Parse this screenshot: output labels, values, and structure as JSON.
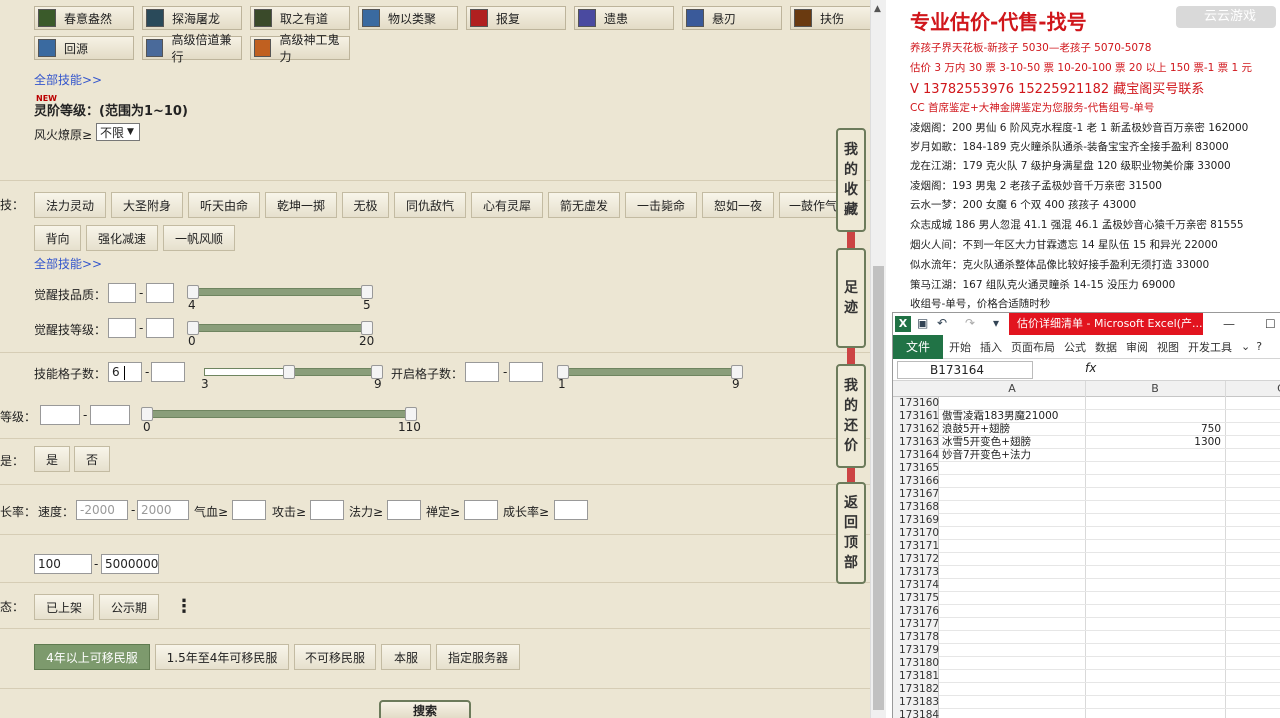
{
  "skills_top": [
    "春意盎然",
    "探海屠龙",
    "取之有道",
    "物以类聚",
    "报复",
    "遗患",
    "悬刃",
    "扶伤",
    "回源",
    "高级倍道兼行",
    "高级神工鬼力"
  ],
  "all_skills_link": "全部技能>>",
  "new_tag": "NEW",
  "lingjie_label": "灵阶等级：(范围为1~10)",
  "fenghuo_label": "风火燎原≥",
  "fenghuo_value": "不限",
  "texiao_label": "技：",
  "texiao_row1": [
    "法力灵动",
    "大圣附身",
    "听天由命",
    "乾坤一掷",
    "无极",
    "同仇敌忾",
    "心有灵犀",
    "箭无虚发",
    "一击毙命",
    "恕如一夜",
    "一鼓作气"
  ],
  "texiao_row2": [
    "背向",
    "强化减速",
    "一帆风顺"
  ],
  "all_skills_link2": "全部技能>>",
  "juexing_quality": {
    "label": "觉醒技品质：",
    "min": "4",
    "max": "5"
  },
  "juexing_level": {
    "label": "觉醒技等级：",
    "min": "0",
    "max": "20"
  },
  "skill_slots": {
    "label": "技能格子数：",
    "value": "6",
    "min": "3",
    "max": "9",
    "selected": 6
  },
  "open_slots": {
    "label": "开启格子数：",
    "min": "1",
    "max": "9"
  },
  "level": {
    "label": "等级：",
    "min": "0",
    "max": "110"
  },
  "yesno_label": "是：",
  "yes": "是",
  "no": "否",
  "growth": {
    "label": "长率：",
    "speed_label": "速度：",
    "speed_min": "-2000",
    "speed_max": "2000",
    "qixue": "气血≥",
    "gongji": "攻击≥",
    "fali": "法力≥",
    "chanding": "禅定≥",
    "chengzhang": "成长率≥"
  },
  "price": {
    "min": "100",
    "max": "5000000"
  },
  "status_label": "态：",
  "status": [
    "已上架",
    "公示期"
  ],
  "server_options": [
    "4年以上可移民服",
    "1.5年至4年可移民服",
    "不可移民服",
    "本服",
    "指定服务器"
  ],
  "search": "搜索",
  "side_tabs": [
    [
      "我",
      "的",
      "收",
      "藏"
    ],
    [
      "足",
      "迹"
    ],
    [
      "我",
      "的",
      "还",
      "价"
    ],
    [
      "返",
      "回",
      "顶",
      "部"
    ]
  ],
  "ad": {
    "title": "专业估价-代售-找号",
    "watermark": "云云游戏",
    "lines": [
      "养孩子界天花板-新孩子 5030—老孩子 5070-5078",
      "估价 3 万内 30 票  3-10-50 票  10-20-100 票  20 以上 150 票-1 票 1 元",
      "V 13782553976    15225921182   藏宝阁买号联系",
      "CC 首席鉴定+大神金牌鉴定为您服务-代售组号-单号",
      "凌烟阁：200 男仙 6 阶风克水程度-1 老 1 新孟极妙音百万亲密 162000",
      "岁月如歌：184-189 克火瞳杀队通杀-装备宝宝齐全接手盈利 83000",
      "龙在江湖：179 克火队 7 级护身满星盘 120 级职业物美价廉 33000",
      "凌烟阁：193 男鬼 2 老孩子孟极妙音千万亲密 31500",
      "云水一梦：200 女魔 6 个双 400 孩孩子 43000",
      "众志成城 186 男人忽混 41.1 强混 46.1 孟极妙音心猿千万亲密 81555",
      "烟火人间：不到一年区大力甘霖遗忘 14 星队伍 15 和异光 22000",
      "似水流年：克火队通杀整体品像比较好接手盈利无须打造 33000",
      "策马江湖：167 组队克火通灵瞳杀 14-15 没压力 69000",
      "收组号-单号，价格合适随时秒"
    ]
  },
  "excel": {
    "title": "估价详细清单 - Microsoft Excel(产...",
    "file_tab": "文件",
    "tabs": [
      "开始",
      "插入",
      "页面布局",
      "公式",
      "数据",
      "审阅",
      "视图",
      "开发工具"
    ],
    "namebox": "B173164",
    "fx": "fx",
    "col_a": "A",
    "col_b": "B",
    "col_c": "C",
    "rows": [
      {
        "n": "173160",
        "a": "",
        "b": ""
      },
      {
        "n": "173161",
        "a": "傲雪凌霜183男魔21000",
        "b": ""
      },
      {
        "n": "173162",
        "a": "浪鼓5开+翅膀",
        "b": "750"
      },
      {
        "n": "173163",
        "a": "冰雪5开变色+翅膀",
        "b": "1300"
      },
      {
        "n": "173164",
        "a": "妙音7开变色+法力",
        "b": ""
      },
      {
        "n": "173165",
        "a": "",
        "b": ""
      },
      {
        "n": "173166",
        "a": "",
        "b": ""
      },
      {
        "n": "173167",
        "a": "",
        "b": ""
      },
      {
        "n": "173168",
        "a": "",
        "b": ""
      },
      {
        "n": "173169",
        "a": "",
        "b": ""
      },
      {
        "n": "173170",
        "a": "",
        "b": ""
      },
      {
        "n": "173171",
        "a": "",
        "b": ""
      },
      {
        "n": "173172",
        "a": "",
        "b": ""
      },
      {
        "n": "173173",
        "a": "",
        "b": ""
      },
      {
        "n": "173174",
        "a": "",
        "b": ""
      },
      {
        "n": "173175",
        "a": "",
        "b": ""
      },
      {
        "n": "173176",
        "a": "",
        "b": ""
      },
      {
        "n": "173177",
        "a": "",
        "b": ""
      },
      {
        "n": "173178",
        "a": "",
        "b": ""
      },
      {
        "n": "173179",
        "a": "",
        "b": ""
      },
      {
        "n": "173180",
        "a": "",
        "b": ""
      },
      {
        "n": "173181",
        "a": "",
        "b": ""
      },
      {
        "n": "173182",
        "a": "",
        "b": ""
      },
      {
        "n": "173183",
        "a": "",
        "b": ""
      },
      {
        "n": "173184",
        "a": "",
        "b": ""
      }
    ]
  }
}
